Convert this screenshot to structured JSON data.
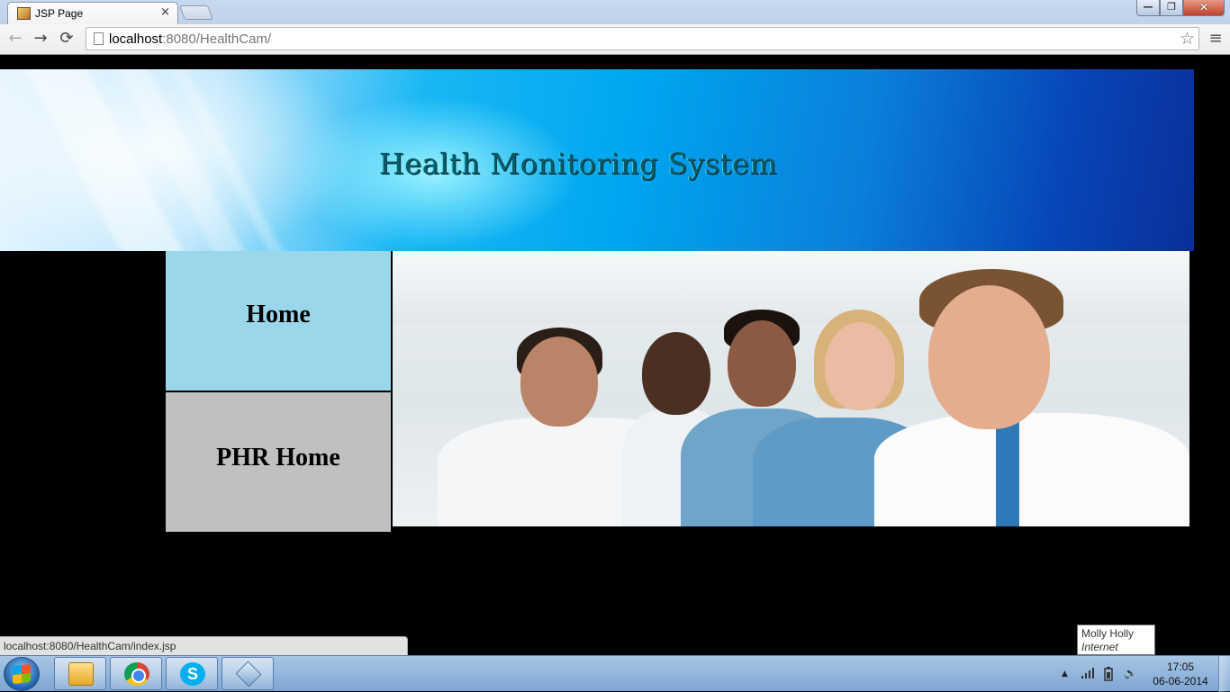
{
  "browser": {
    "tab_title": "JSP Page",
    "tab_close": "×",
    "url_host": "localhost",
    "url_rest": ":8080/HealthCam/",
    "back_icon": "←",
    "forward_icon": "→",
    "reload_icon": "⟳",
    "star_icon": "☆",
    "menu_icon": "≡",
    "window_min": "—",
    "window_max": "❐",
    "window_close": "✕"
  },
  "page": {
    "banner_title": "Health Monitoring System",
    "nav": {
      "home_label": "Home",
      "phr_label": "PHR Home"
    }
  },
  "status_url": "localhost:8080/HealthCam/index.jsp",
  "tooltip": {
    "title": "Molly Holly",
    "subtitle": "Internet access"
  },
  "taskbar": {
    "time": "17:05",
    "date": "06-06-2014",
    "skype_letter": "S",
    "tray_arrow": "▲",
    "tray_volume": "🔈"
  },
  "colors": {
    "home_bg": "#9ad7ea",
    "phr_bg": "#c0c0c0",
    "banner_title": "#0c5b6a"
  }
}
